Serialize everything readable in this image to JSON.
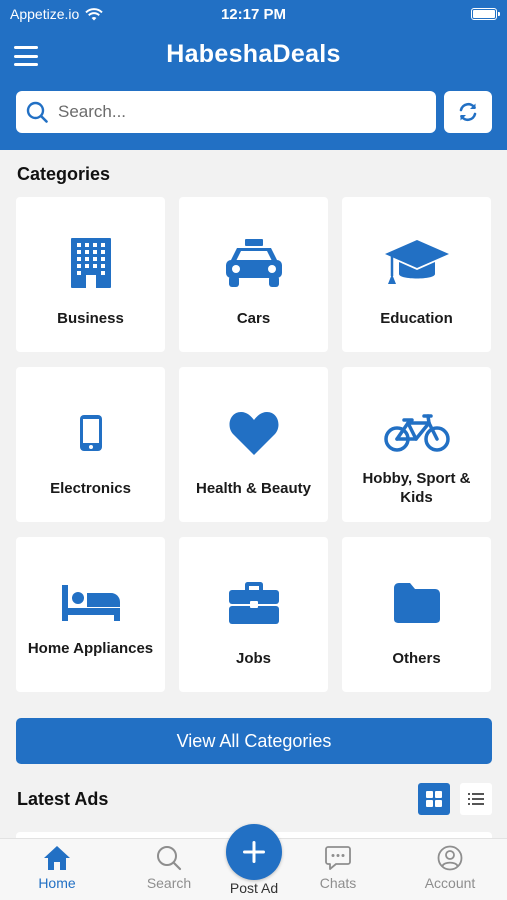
{
  "status_bar": {
    "carrier": "Appetize.io",
    "time": "12:17 PM"
  },
  "header": {
    "title": "HabeshaDeals",
    "search_placeholder": "Search..."
  },
  "categories": {
    "title": "Categories",
    "items": [
      {
        "label": "Business",
        "icon": "building-icon"
      },
      {
        "label": "Cars",
        "icon": "taxi-icon"
      },
      {
        "label": "Education",
        "icon": "graduation-cap-icon"
      },
      {
        "label": "Electronics",
        "icon": "mobile-phone-icon"
      },
      {
        "label": "Health & Beauty",
        "icon": "heart-icon"
      },
      {
        "label": "Hobby, Sport & Kids",
        "icon": "bicycle-icon"
      },
      {
        "label": "Home Appliances",
        "icon": "bed-icon"
      },
      {
        "label": "Jobs",
        "icon": "briefcase-icon"
      },
      {
        "label": "Others",
        "icon": "folder-icon"
      }
    ],
    "view_all_label": "View All Categories"
  },
  "latest_ads": {
    "title": "Latest Ads"
  },
  "tab_bar": {
    "home": "Home",
    "search": "Search",
    "post_ad": "Post Ad",
    "chats": "Chats",
    "account": "Account"
  },
  "colors": {
    "primary": "#2270c4",
    "inactive": "#8e8e8e",
    "background": "#f2f2f2"
  }
}
